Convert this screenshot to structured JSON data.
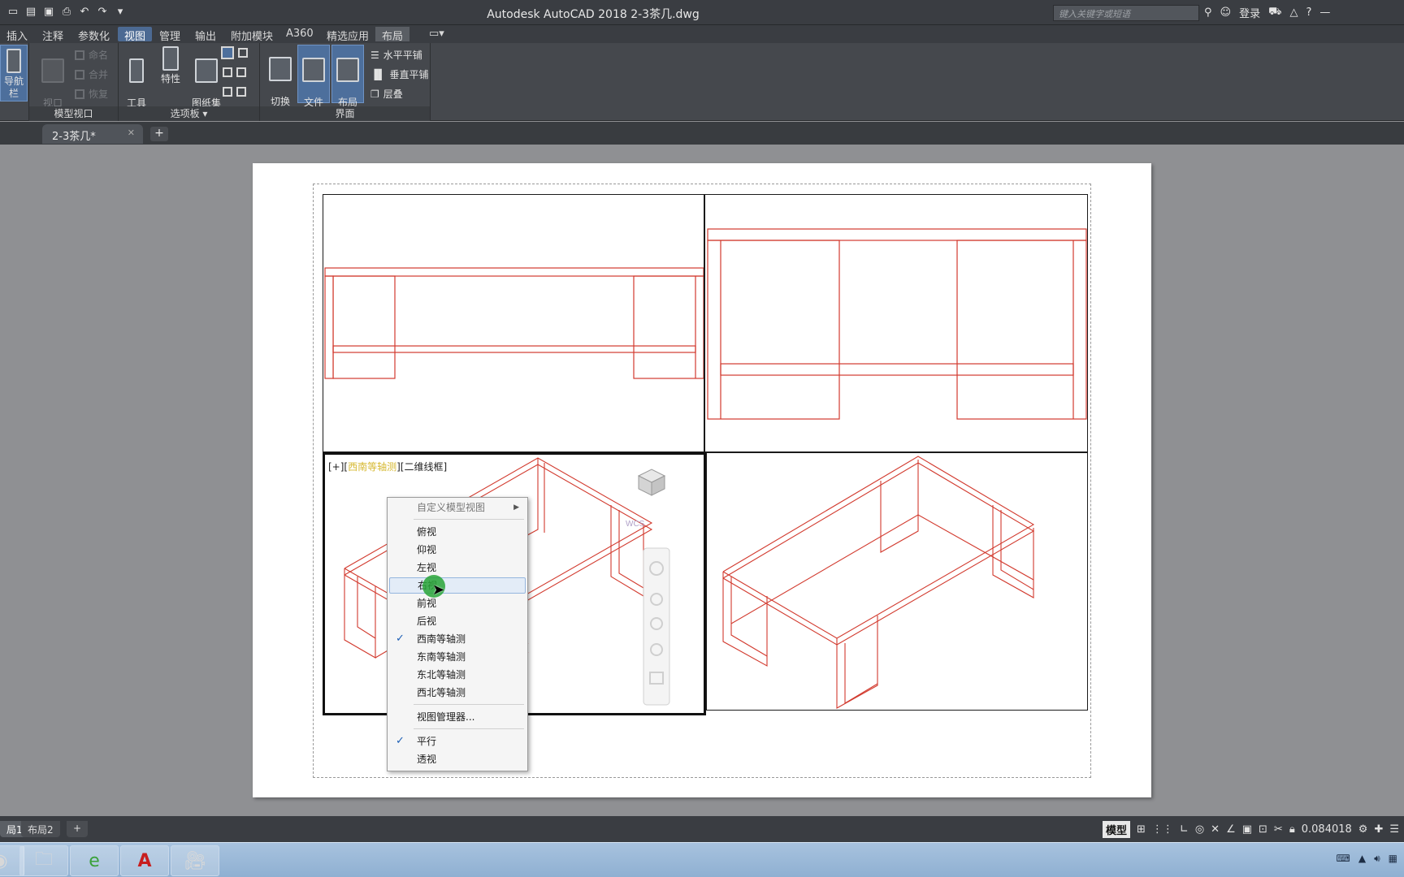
{
  "app": {
    "title": "Autodesk AutoCAD 2018    2-3茶几.dwg",
    "search_placeholder": "键入关键字或短语",
    "login_label": "登录"
  },
  "menu": {
    "tabs": [
      "插入",
      "注释",
      "参数化",
      "视图",
      "管理",
      "输出",
      "附加模块",
      "A360",
      "精选应用",
      "布局"
    ],
    "active_index": 3,
    "highlight_index": 9
  },
  "ribbon": {
    "nav_label": "导航栏",
    "viewport_config_label": "视口\n配置",
    "viewport_small": [
      "命名",
      "合并",
      "恢复"
    ],
    "model_viewport_title": "模型视口",
    "tool_palette_label": "工具\n选项板",
    "properties_label": "特性",
    "sheetset_label": "图纸集\n管理器",
    "palettes_title": "选项板",
    "switch_window_label": "切换\n窗口",
    "file_tabs_label": "文件\n选项卡",
    "layout_tabs_label": "布局\n选项卡",
    "tile_horizontal": "水平平铺",
    "tile_vertical": "垂直平铺",
    "cascade": "层叠",
    "interface_title": "界面"
  },
  "document": {
    "tab_label": "2-3茶几*",
    "viewport_label_prefix": "[+][",
    "viewport_label_view": "西南等轴测",
    "viewport_label_suffix": "][二维线框]",
    "wcs_label": "WCS"
  },
  "context_menu": {
    "custom_views": "自定义模型视图",
    "items": [
      {
        "label": "俯视",
        "checked": false
      },
      {
        "label": "仰视",
        "checked": false
      },
      {
        "label": "左视",
        "checked": false
      },
      {
        "label": "右视",
        "checked": false,
        "hover": true
      },
      {
        "label": "前视",
        "checked": false
      },
      {
        "label": "后视",
        "checked": false
      },
      {
        "label": "西南等轴测",
        "checked": true
      },
      {
        "label": "东南等轴测",
        "checked": false
      },
      {
        "label": "东北等轴测",
        "checked": false
      },
      {
        "label": "西北等轴测",
        "checked": false
      }
    ],
    "view_manager": "视图管理器...",
    "parallel": "平行",
    "perspective": "透视"
  },
  "layout_tabs": [
    "局1",
    "布局2"
  ],
  "status": {
    "model_label": "模型",
    "scale_value": "0.084018"
  },
  "colors": {
    "drawing_red": "#d23a2e",
    "accent_blue": "#4c6a93"
  }
}
